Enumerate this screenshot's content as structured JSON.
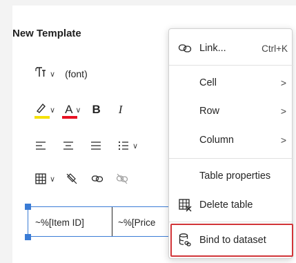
{
  "editor": {
    "title": "New Template",
    "font_label": "(font)",
    "colors": {
      "highlight": "#f5e10a",
      "font_color": "#e81123"
    }
  },
  "table": {
    "cell_1": "~%[Item ID]",
    "cell_2": "~%[Price"
  },
  "context_menu": {
    "link": {
      "label": "Link...",
      "shortcut": "Ctrl+K",
      "icon": "link-icon"
    },
    "cell": {
      "label": "Cell",
      "icon": "chevron-right-icon"
    },
    "row": {
      "label": "Row",
      "icon": "chevron-right-icon"
    },
    "column": {
      "label": "Column",
      "icon": "chevron-right-icon"
    },
    "table_properties": {
      "label": "Table properties"
    },
    "delete_table": {
      "label": "Delete table",
      "icon": "delete-table-icon"
    },
    "bind_to_dataset": {
      "label": "Bind to dataset",
      "icon": "database-bind-icon"
    }
  }
}
